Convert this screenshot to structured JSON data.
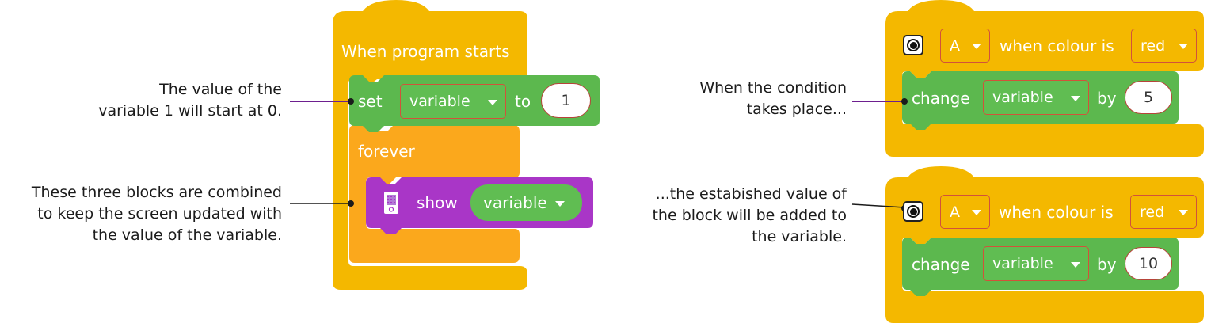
{
  "colors": {
    "event_yellow": "#f4b800",
    "control_orange": "#fba81c",
    "variable_green": "#5cb84e",
    "display_purple": "#a936c7",
    "connector_purple": "#6d1f8f",
    "dropdown_border": "#d2523a"
  },
  "annotations": {
    "a1": [
      "The value of the",
      "variable 1 will start at 0."
    ],
    "a2": [
      "These three blocks are combined",
      "to keep the screen updated with",
      "the value of the variable."
    ],
    "a3": [
      "When the condition",
      "takes place..."
    ],
    "a4": [
      "...the estabished value of",
      "the block will be added to",
      "the variable."
    ]
  },
  "main_stack": {
    "hat_label": "When program starts",
    "set_label": "set",
    "set_var": "variable",
    "set_to": "to",
    "set_value": "1",
    "forever_label": "forever",
    "show_icon": "display-screen-icon",
    "show_label": "show",
    "show_var": "variable"
  },
  "event_stack_1": {
    "port_icon": "hub-port-icon",
    "port": "A",
    "when_label": "when colour is",
    "colour": "red",
    "change_label": "change",
    "var": "variable",
    "by_label": "by",
    "amount": "5"
  },
  "event_stack_2": {
    "port_icon": "hub-port-icon",
    "port": "A",
    "when_label": "when colour is",
    "colour": "red",
    "change_label": "change",
    "var": "variable",
    "by_label": "by",
    "amount": "10"
  }
}
